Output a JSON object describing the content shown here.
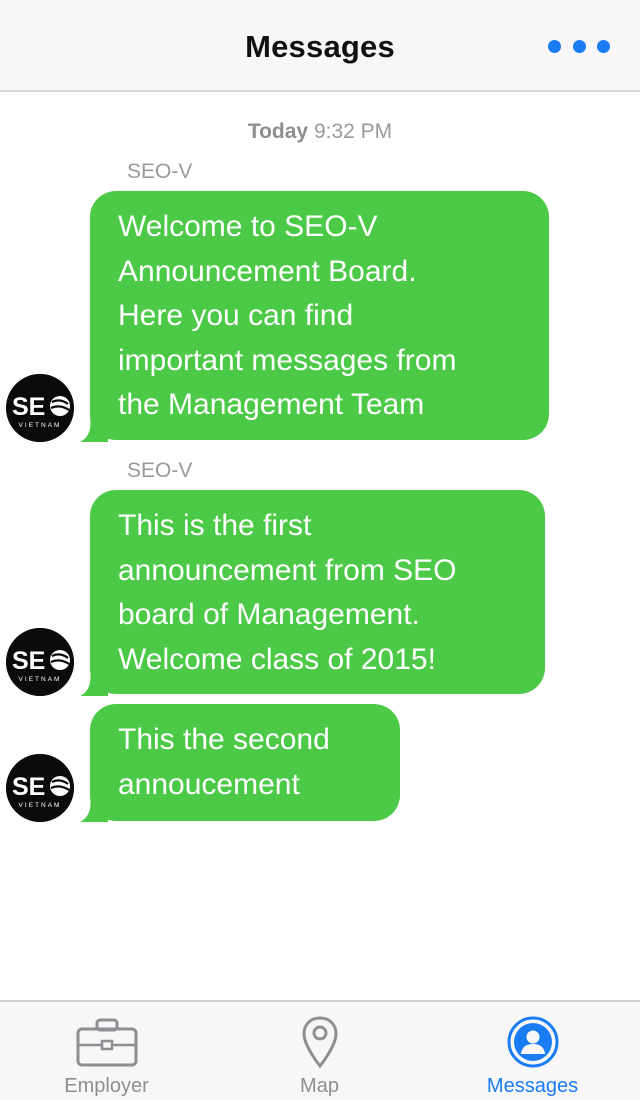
{
  "header": {
    "title": "Messages",
    "more_icon": "more-dots-icon"
  },
  "thread": {
    "timestamp_day": "Today",
    "timestamp_time": "9:32 PM",
    "messages": [
      {
        "sender": "SEO-V",
        "text": "Welcome to SEO-V\nAnnouncement Board.\nHere you can find\nimportant messages from\nthe Management Team"
      },
      {
        "sender": "SEO-V",
        "text": "This is the first\nannouncement from SEO\nboard of Management.\nWelcome class of 2015!"
      },
      {
        "sender": "",
        "text": "This the second\nannoucement"
      }
    ],
    "avatar_logo_text": "SEO",
    "avatar_logo_subtext": "VIETNAM"
  },
  "tabbar": {
    "tabs": [
      {
        "label": "Employer",
        "icon": "briefcase-icon",
        "active": false
      },
      {
        "label": "Map",
        "icon": "map-pin-icon",
        "active": false
      },
      {
        "label": "Messages",
        "icon": "person-circle-icon",
        "active": true
      }
    ]
  },
  "colors": {
    "accent": "#1a7cf4",
    "bubble": "#4cca47"
  }
}
